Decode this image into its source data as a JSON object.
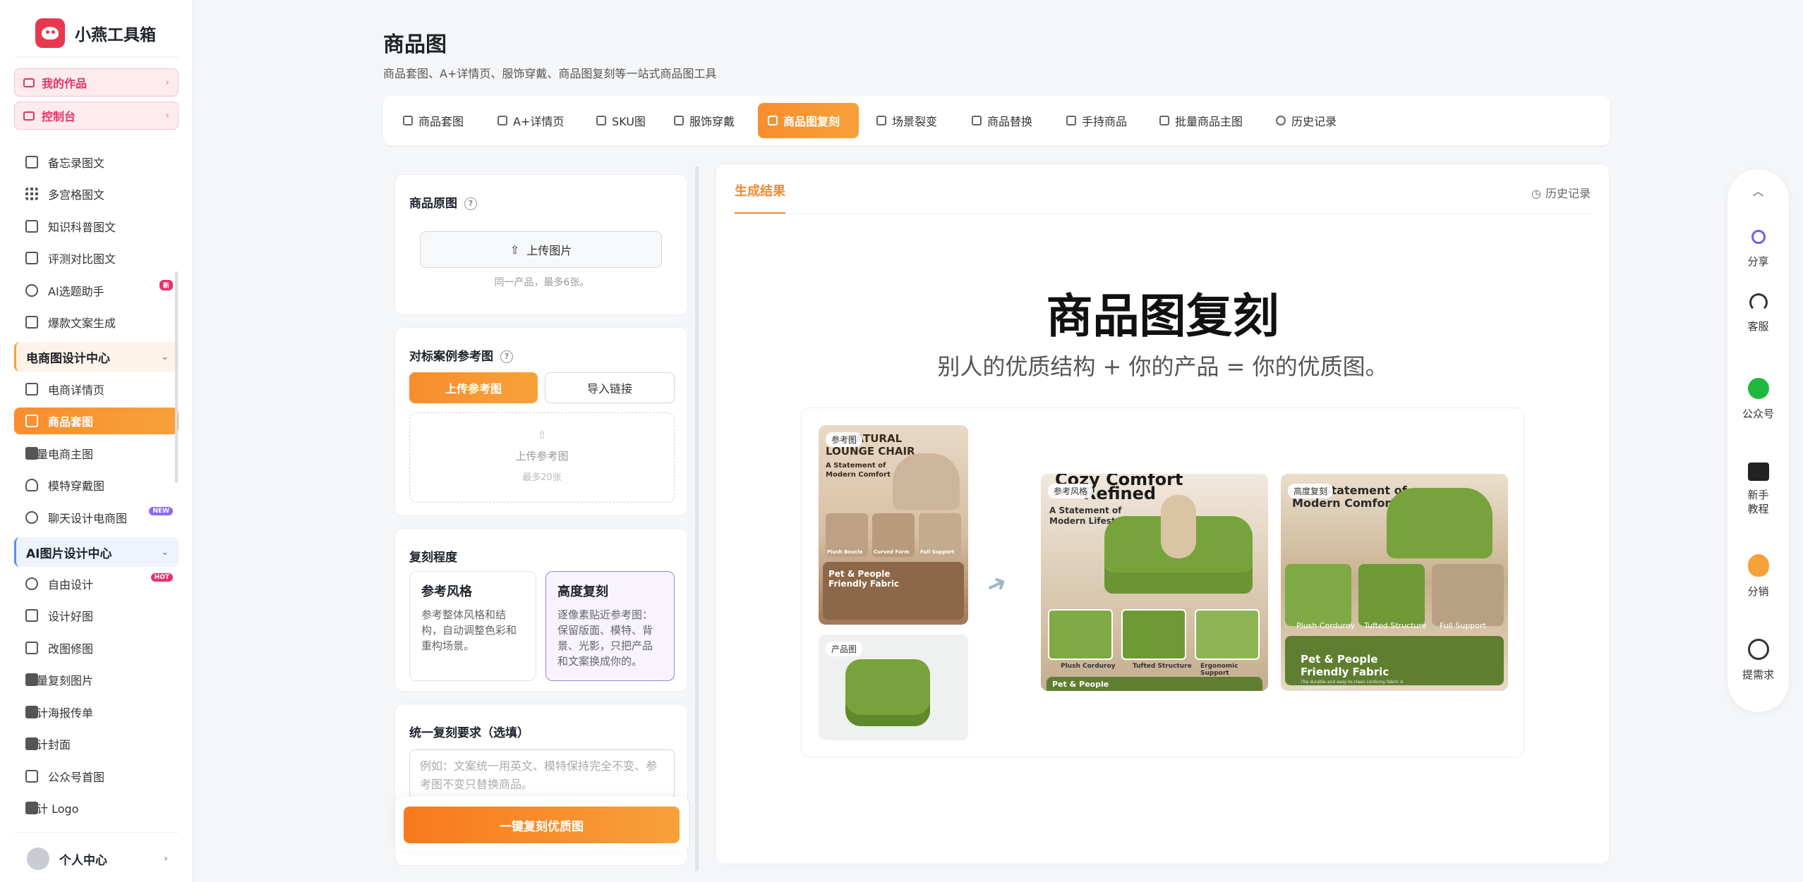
{
  "app": {
    "name": "小燕工具箱"
  },
  "sidebar": {
    "top": [
      {
        "label": "我的作品"
      },
      {
        "label": "控制台"
      }
    ],
    "items1": [
      {
        "label": "备忘录图文",
        "icon": "notebook-icon"
      },
      {
        "label": "多宫格图文",
        "icon": "grid-icon"
      },
      {
        "label": "知识科普图文",
        "icon": "book-icon"
      },
      {
        "label": "评测对比图文",
        "icon": "book-open-icon"
      },
      {
        "label": "AI选题助手",
        "icon": "compass-icon",
        "badge": "新"
      },
      {
        "label": "爆款文案生成",
        "icon": "document-icon"
      }
    ],
    "section1": "电商图设计中心",
    "items2": [
      {
        "label": "电商详情页",
        "icon": "shopping-bag-icon"
      },
      {
        "label": "商品套图",
        "icon": "shopping-bag-icon",
        "active": true
      },
      {
        "label": "批量电商主图",
        "icon": "image-icon"
      },
      {
        "label": "模特穿戴图",
        "icon": "user-icon"
      },
      {
        "label": "聊天设计电商图",
        "icon": "chat-icon",
        "badge": "NEW"
      }
    ],
    "section2": "AI图片设计中心",
    "items3": [
      {
        "label": "自由设计",
        "icon": "sparkle-icon",
        "badge": "HOT"
      },
      {
        "label": "设计好图",
        "icon": "image-icon"
      },
      {
        "label": "改图修图",
        "icon": "pencil-icon"
      },
      {
        "label": "批量复刻图片",
        "icon": "image-icon"
      },
      {
        "label": "设计海报传单",
        "icon": "image-icon"
      },
      {
        "label": "设计封面",
        "icon": "image-icon"
      },
      {
        "label": "公众号首图",
        "icon": "document-icon"
      },
      {
        "label": "设计 Logo",
        "icon": "chart-icon"
      }
    ],
    "profile": "个人中心"
  },
  "page": {
    "title": "商品图",
    "subtitle": "商品套图、A+详情页、服饰穿戴、商品图复刻等一站式商品图工具"
  },
  "tabs": [
    {
      "label": "商品套图"
    },
    {
      "label": "A+详情页"
    },
    {
      "label": "SKU图"
    },
    {
      "label": "服饰穿戴"
    },
    {
      "label": "商品图复刻",
      "active": true
    },
    {
      "label": "场景裂变"
    },
    {
      "label": "商品替换"
    },
    {
      "label": "手持商品"
    },
    {
      "label": "批量商品主图"
    },
    {
      "label": "历史记录"
    }
  ],
  "form": {
    "original": {
      "title": "商品原图",
      "upload": "上传图片",
      "hint": "同一产品，最多6张。"
    },
    "reference": {
      "title": "对标案例参考图",
      "upload_btn": "上传参考图",
      "import_btn": "导入链接",
      "drop_label": "上传参考图",
      "drop_hint": "最多20张"
    },
    "degree": {
      "title": "复刻程度",
      "options": [
        {
          "title": "参考风格",
          "desc": "参考整体风格和结构，自动调整色彩和重构场景。"
        },
        {
          "title": "高度复刻",
          "desc": "逐像素贴近参考图：保留版面、模特、背景、光影，只把产品和文案换成你的。",
          "selected": true
        }
      ]
    },
    "requirement": {
      "title": "统一复刻要求（选填）",
      "placeholder": "例如：文案统一用英文、模特保持完全不变、参考图不变只替换商品。"
    },
    "submit": "一键复刻优质图"
  },
  "result": {
    "tab": "生成结果",
    "history": "历史记录",
    "hero_title": "商品图复刻",
    "hero_sub": "别人的优质结构 + 你的产品 = 你的优质图。",
    "tags": {
      "ref": "参考图",
      "product": "产品图",
      "style": "参考风格",
      "high": "高度复刻"
    },
    "ref_img": {
      "l1": "NATURAL",
      "l2": "LOUNGE CHAIR",
      "l3": "A Statement of",
      "l4": "Modern Comfort",
      "c1": "Plush Boucle",
      "c2": "Curved Form",
      "c3": "Full Support",
      "p1": "Pet & People",
      "p2": "Friendly Fabric"
    },
    "style_img": {
      "l1": "Cozy Comfort",
      "l2": "Refined",
      "l3": "A Statement of",
      "l4": "Modern Lifestyle",
      "c1": "Plush Corduroy",
      "c2": "Tufted Structure",
      "c3": "Ergonomic Support",
      "p1": "Pet & People"
    },
    "high_img": {
      "l1": "Statement of",
      "l2": "Modern Comfort",
      "c1": "Plush Corduroy",
      "c2": "Tufted Structure",
      "c3": "Full Support",
      "p1": "Pet & People",
      "p2": "Friendly Fabric",
      "p3": "The durable and easy-to-clean corduroy fabric is designed for daily life."
    }
  },
  "floatbar": [
    {
      "label": "分享",
      "icon": "share-icon"
    },
    {
      "label": "客服",
      "icon": "headset-icon"
    },
    {
      "label": "公众号",
      "icon": "wechat-icon"
    },
    {
      "label": "新手教程",
      "icon": "book-icon"
    },
    {
      "label": "分销",
      "icon": "money-bag-icon"
    },
    {
      "label": "提需求",
      "icon": "chat-icon"
    }
  ],
  "colors": {
    "accent": "#f98d2e",
    "pink": "#e5326a",
    "purple": "#9b86d6",
    "green": "#7a9a3a"
  }
}
